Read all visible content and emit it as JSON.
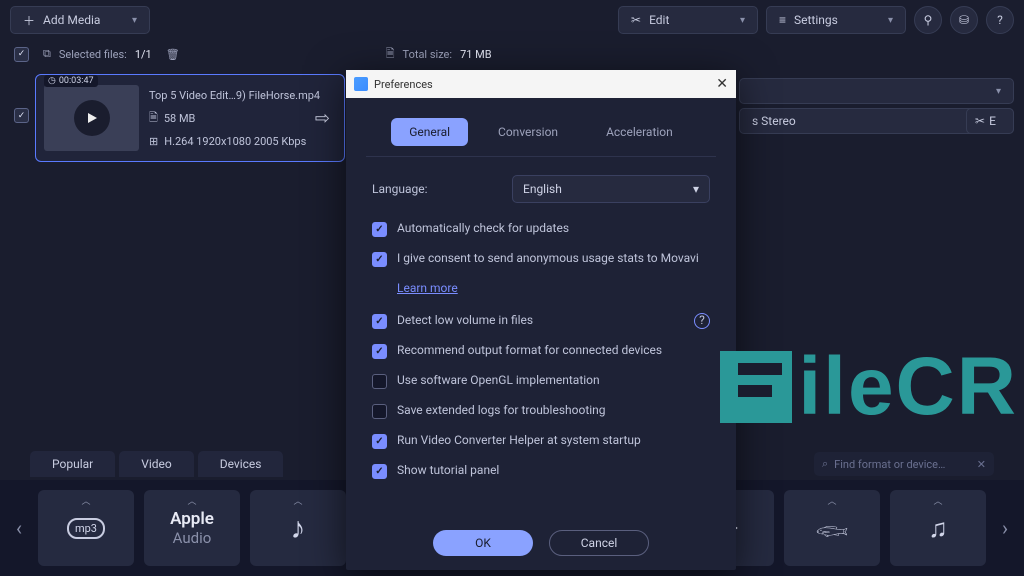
{
  "topbar": {
    "add_media": "Add Media",
    "edit": "Edit",
    "settings": "Settings"
  },
  "infobar": {
    "selected_label": "Selected files:",
    "selected_count": "1/1",
    "total_label": "Total size:",
    "total_value": "71 MB"
  },
  "media": {
    "duration": "00:03:47",
    "title": "Top 5 Video Edit…9) FileHorse.mp4",
    "size": "58 MB",
    "codec": "H.264 1920x1080 2005 Kbps"
  },
  "right": {
    "audio_label": "s Stereo",
    "edit_suffix": "E"
  },
  "tabs": {
    "popular": "Popular",
    "video": "Video",
    "devices": "Devices"
  },
  "search": {
    "placeholder": "Find format or device…"
  },
  "formats": {
    "mp3": "mp3",
    "apple_line1": "Apple",
    "apple_line2": "Audio"
  },
  "modal": {
    "title": "Preferences",
    "tabs": {
      "general": "General",
      "conversion": "Conversion",
      "acceleration": "Acceleration"
    },
    "language_label": "Language:",
    "language_value": "English",
    "opt_updates": "Automatically check for updates",
    "opt_consent": "I give consent to send anonymous usage stats to Movavi",
    "learn_more": "Learn more",
    "opt_lowvol": "Detect low volume in files",
    "opt_recommend": "Recommend output format for connected devices",
    "opt_opengl": "Use software OpenGL implementation",
    "opt_logs": "Save extended logs for troubleshooting",
    "opt_helper": "Run Video Converter Helper at system startup",
    "opt_tutorial": "Show tutorial panel",
    "ok": "OK",
    "cancel": "Cancel"
  },
  "watermark": "ileCR"
}
